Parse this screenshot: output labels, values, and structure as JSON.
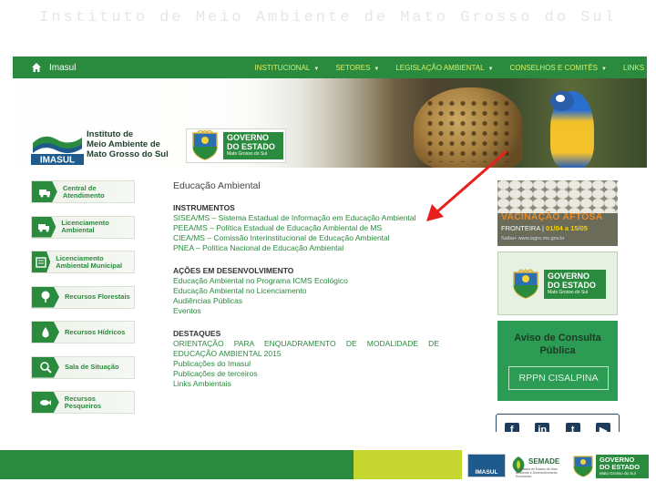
{
  "slide": {
    "title": "Instituto de Meio Ambiente de Mato Grosso do Sul"
  },
  "nav": {
    "home_label": "Imasul",
    "items": [
      {
        "label": "INSTITUCIONAL"
      },
      {
        "label": "SETORES"
      },
      {
        "label": "LEGISLAÇÃO AMBIENTAL"
      },
      {
        "label": "CONSELHOS E COMITÊS"
      },
      {
        "label": "LINKS"
      }
    ]
  },
  "header": {
    "logo_word": "IMASUL",
    "logo_lines": [
      "Instituto de",
      "Meio Ambiente de",
      "Mato Grosso do Sul"
    ],
    "gov_line1": "GOVERNO",
    "gov_line2": "DO ESTADO",
    "gov_line3": "Mato Grosso do Sul"
  },
  "sidebar": {
    "items": [
      {
        "label": "Central de Atendimento",
        "icon": "truck-icon"
      },
      {
        "label": "Licenciamento Ambiental",
        "icon": "truck-icon"
      },
      {
        "label": "Licenciamento Ambiental Municipal",
        "icon": "document-icon"
      },
      {
        "label": "Recursos Florestais",
        "icon": "tree-icon"
      },
      {
        "label": "Recursos Hídricos",
        "icon": "water-drop-icon"
      },
      {
        "label": "Sala de Situação",
        "icon": "magnifier-icon"
      },
      {
        "label": "Recursos Pesqueiros",
        "icon": "fish-icon"
      }
    ]
  },
  "main": {
    "title": "Educação Ambiental",
    "sections": [
      {
        "heading": "INSTRUMENTOS",
        "links": [
          "SISEA/MS – Sistema Estadual de Informação em Educação Ambiental",
          "PEEA/MS – Política Estadual de Educação Ambiental de MS",
          "CIEA/MS – Comissão Interinstitucional de Educação Ambiental",
          "PNEA – Política Nacional de Educação Ambiental"
        ]
      },
      {
        "heading": "AÇÕES EM DESENVOLVIMENTO",
        "links": [
          "Educação Ambiental no Programa ICMS Ecológico",
          "Educação Ambiental no Licenciamento",
          "Audiências Públicas",
          "Eventos"
        ]
      },
      {
        "heading": "DESTAQUES",
        "links": [
          "ORIENTAÇÃO PARA ENQUADRAMENTO DE MODALIDADE DE EDUCAÇÃO AMBIENTAL 2015",
          "Publicações do Imasul",
          "Publicações de terceiros",
          "Links Ambientais"
        ]
      }
    ]
  },
  "right": {
    "aftosa_title": "VACINAÇÃO AFTOSA",
    "aftosa_dates_prefix": "FRONTEIRA | ",
    "aftosa_dates": "01/04 a 15/05",
    "aftosa_url": "Saiba+ www.iagro.ms.gov.br",
    "gov_line1": "GOVERNO",
    "gov_line2": "DO ESTADO",
    "gov_line3": "Mato Grosso do Sul",
    "consulta_title": "Aviso de Consulta Pública",
    "consulta_button": "RPPN CISALPINA",
    "social": [
      "f",
      "in",
      "t",
      "▶"
    ]
  },
  "footer": {
    "imasul": "IMASUL",
    "semade": "SEMADE",
    "semade_sub": "Secretaria de Estado de Meio Ambiente e Desenvolvimento Econômico",
    "gov_line1": "GOVERNO",
    "gov_line2": "DO ESTADO",
    "gov_line3": "Mato Grosso do Sul"
  },
  "colors": {
    "brand_green": "#2a8a3e",
    "nav_text": "#d8f06a",
    "arrow": "#e8201c",
    "footer_lime": "#c5d631"
  }
}
